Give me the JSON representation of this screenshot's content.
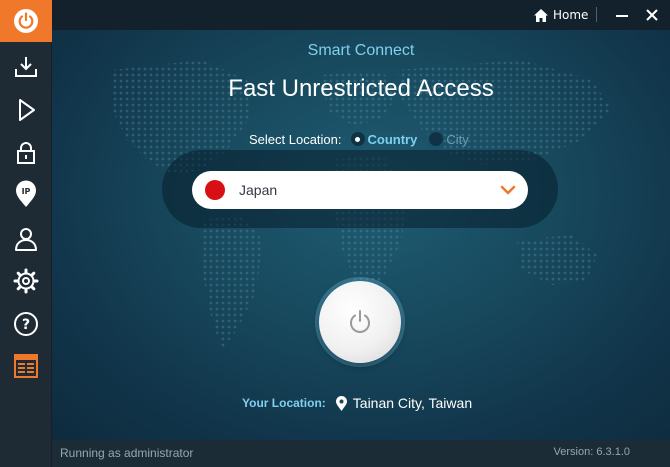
{
  "sidebar": {
    "items": [
      {
        "icon": "power-icon",
        "active": true
      },
      {
        "icon": "download-icon"
      },
      {
        "icon": "play-icon"
      },
      {
        "icon": "lock-icon"
      },
      {
        "icon": "ip-pin-icon",
        "badge": "IP"
      },
      {
        "icon": "user-icon"
      },
      {
        "icon": "gear-icon"
      },
      {
        "icon": "help-icon",
        "symbol": "?"
      },
      {
        "icon": "browser-window-icon"
      }
    ],
    "accent_color": "#f0782a"
  },
  "titlebar": {
    "home_label": "Home",
    "home_icon": "home-icon",
    "minimize_icon": "minimize-icon",
    "close_icon": "close-icon"
  },
  "main": {
    "subtitle": "Smart Connect",
    "headline": "Fast Unrestricted Access",
    "select_location_label": "Select Location:",
    "location_options": [
      {
        "label": "Country",
        "selected": true
      },
      {
        "label": "City",
        "selected": false
      }
    ],
    "selected_country": "Japan",
    "flag_color": "#d90f16",
    "connect_icon": "power-icon",
    "your_location_label": "Your Location:",
    "your_location_value": "Tainan City, Taiwan"
  },
  "statusbar": {
    "left_text": "Running as administrator",
    "right_text": "Version: 6.3.1.0"
  }
}
